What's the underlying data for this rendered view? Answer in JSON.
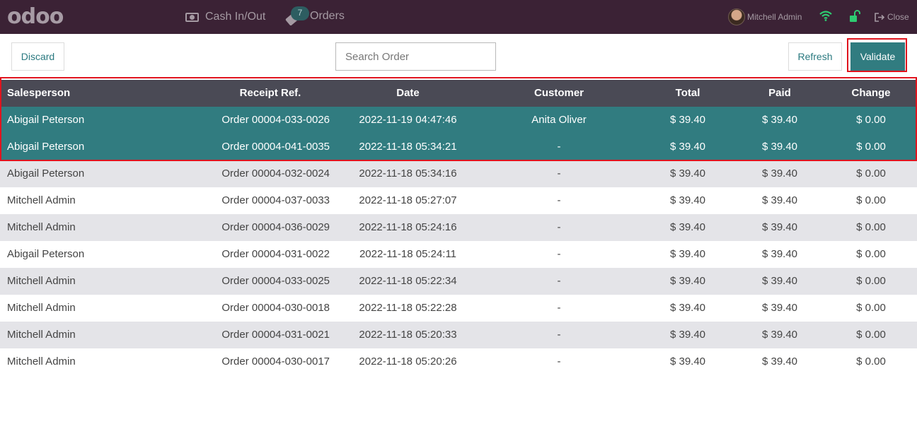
{
  "navbar": {
    "logo": "odoo",
    "cash_label": "Cash In/Out",
    "orders_badge": "7",
    "orders_label": "Orders",
    "user_name": "Mitchell Admin",
    "close_label": "Close"
  },
  "controls": {
    "discard_label": "Discard",
    "search_placeholder": "Search Order",
    "refresh_label": "Refresh",
    "validate_label": "Validate"
  },
  "table": {
    "headers": {
      "salesperson": "Salesperson",
      "receipt": "Receipt Ref.",
      "date": "Date",
      "customer": "Customer",
      "total": "Total",
      "paid": "Paid",
      "change": "Change"
    },
    "rows": [
      {
        "salesperson": "Abigail Peterson",
        "receipt": "Order 00004-033-0026",
        "date": "2022-11-19 04:47:46",
        "customer": "Anita Oliver",
        "total": "$ 39.40",
        "paid": "$ 39.40",
        "change": "$ 0.00",
        "selected": true
      },
      {
        "salesperson": "Abigail Peterson",
        "receipt": "Order 00004-041-0035",
        "date": "2022-11-18 05:34:21",
        "customer": "-",
        "total": "$ 39.40",
        "paid": "$ 39.40",
        "change": "$ 0.00",
        "selected": true
      },
      {
        "salesperson": "Abigail Peterson",
        "receipt": "Order 00004-032-0024",
        "date": "2022-11-18 05:34:16",
        "customer": "-",
        "total": "$ 39.40",
        "paid": "$ 39.40",
        "change": "$ 0.00",
        "selected": false
      },
      {
        "salesperson": "Mitchell Admin",
        "receipt": "Order 00004-037-0033",
        "date": "2022-11-18 05:27:07",
        "customer": "-",
        "total": "$ 39.40",
        "paid": "$ 39.40",
        "change": "$ 0.00",
        "selected": false
      },
      {
        "salesperson": "Mitchell Admin",
        "receipt": "Order 00004-036-0029",
        "date": "2022-11-18 05:24:16",
        "customer": "-",
        "total": "$ 39.40",
        "paid": "$ 39.40",
        "change": "$ 0.00",
        "selected": false
      },
      {
        "salesperson": "Abigail Peterson",
        "receipt": "Order 00004-031-0022",
        "date": "2022-11-18 05:24:11",
        "customer": "-",
        "total": "$ 39.40",
        "paid": "$ 39.40",
        "change": "$ 0.00",
        "selected": false
      },
      {
        "salesperson": "Mitchell Admin",
        "receipt": "Order 00004-033-0025",
        "date": "2022-11-18 05:22:34",
        "customer": "-",
        "total": "$ 39.40",
        "paid": "$ 39.40",
        "change": "$ 0.00",
        "selected": false
      },
      {
        "salesperson": "Mitchell Admin",
        "receipt": "Order 00004-030-0018",
        "date": "2022-11-18 05:22:28",
        "customer": "-",
        "total": "$ 39.40",
        "paid": "$ 39.40",
        "change": "$ 0.00",
        "selected": false
      },
      {
        "salesperson": "Mitchell Admin",
        "receipt": "Order 00004-031-0021",
        "date": "2022-11-18 05:20:33",
        "customer": "-",
        "total": "$ 39.40",
        "paid": "$ 39.40",
        "change": "$ 0.00",
        "selected": false
      },
      {
        "salesperson": "Mitchell Admin",
        "receipt": "Order 00004-030-0017",
        "date": "2022-11-18 05:20:26",
        "customer": "-",
        "total": "$ 39.40",
        "paid": "$ 39.40",
        "change": "$ 0.00",
        "selected": false
      }
    ]
  },
  "colors": {
    "navbar": "#3b2235",
    "accent": "#317c80",
    "header": "#4a4a55",
    "alt_row": "#e4e4e8",
    "highlight_frame": "#e0141e",
    "wifi": "#2ecc71"
  }
}
